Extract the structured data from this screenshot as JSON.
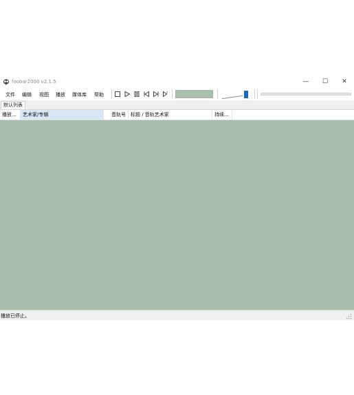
{
  "window": {
    "title": "foobar2000 v2.1.5",
    "minimize_glyph": "—",
    "maximize_glyph": "☐",
    "close_glyph": "✕"
  },
  "menu": {
    "items": [
      "文件",
      "编辑",
      "视图",
      "播放",
      "媒体库",
      "帮助"
    ]
  },
  "toolbar": {
    "buttons": [
      "stop-icon",
      "play-icon",
      "pause-icon",
      "previous-icon",
      "next-icon",
      "random-icon"
    ]
  },
  "visualization_color": "#a9c0ae",
  "volume_handle_color": "#1769c4",
  "tabs": [
    "默认列表"
  ],
  "columns": {
    "playing": "播放...",
    "artist_album": "艺术家/专辑",
    "track_no": "音轨号",
    "title_artist": "标题 / 音轨艺术家",
    "duration": "持续..."
  },
  "playlist_bg": "#a9bfae",
  "status": "播放已停止。"
}
